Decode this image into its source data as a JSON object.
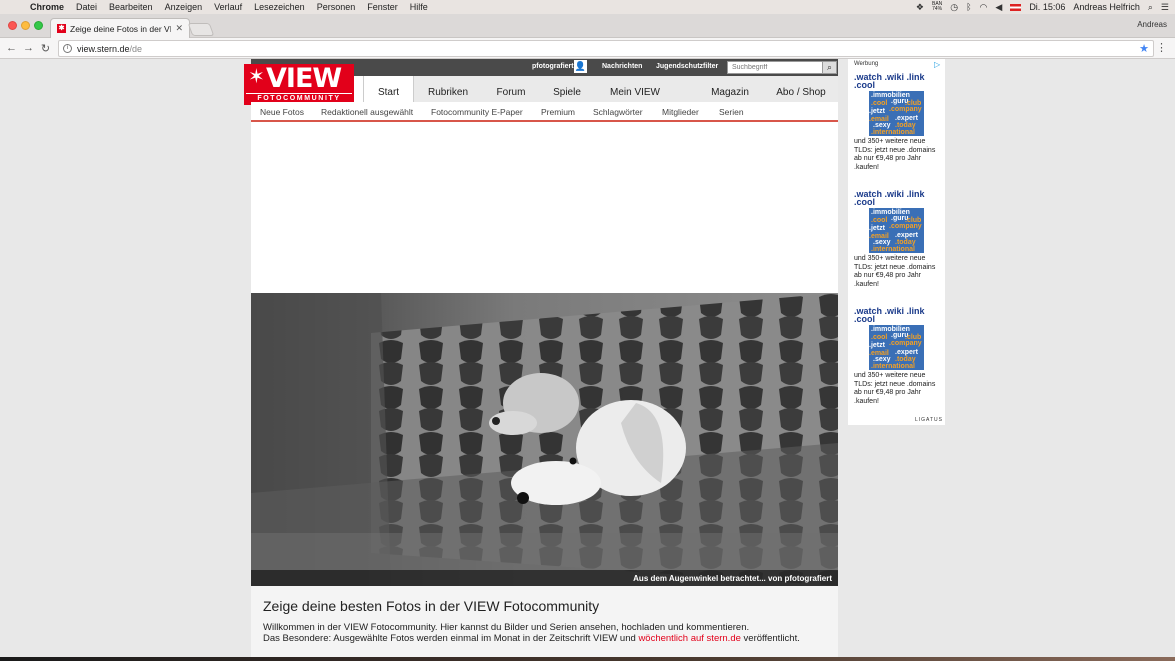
{
  "menubar": {
    "app": "Chrome",
    "items": [
      "Datei",
      "Bearbeiten",
      "Anzeigen",
      "Verlauf",
      "Lesezeichen",
      "Personen",
      "Fenster",
      "Hilfe"
    ],
    "battery": "74%",
    "battery_top": "BAN",
    "clock": "Di. 15:06",
    "user": "Andreas Helfrich"
  },
  "browser": {
    "tab_title": "Zeige deine Fotos in der VIEW",
    "profile": "Andreas",
    "url_host": "view.stern.de",
    "url_path": "/de"
  },
  "site": {
    "topbar": [
      "pfotografiert",
      "Nachrichten",
      "Jugendschutzfilter"
    ],
    "search_placeholder": "Suchbegriff",
    "logo_word": "VIEW",
    "logo_sub": "FOTOCOMMUNITY",
    "main_nav": [
      "Start",
      "Rubriken",
      "Forum",
      "Spiele",
      "Mein VIEW",
      "Magazin",
      "Abo / Shop"
    ],
    "sub_nav": [
      "Neue Fotos",
      "Redaktionell ausgewählt",
      "Fotocommunity E-Paper",
      "Premium",
      "Schlagwörter",
      "Mitglieder",
      "Serien"
    ],
    "hero_caption": "Aus dem Augenwinkel betrachtet... von pfotografiert",
    "headline": "Zeige deine besten Fotos in der VIEW Fotocommunity",
    "intro_line1": "Willkommen in der VIEW Fotocommunity. Hier kannst du Bilder und Serien ansehen, hochladen und kommentieren.",
    "intro_line2_prefix": "Das Besondere: Ausgewählte Fotos werden einmal im Monat in der Zeitschrift VIEW und ",
    "intro_link": "wöchentlich auf stern.de",
    "intro_line2_suffix": " veröffentlicht."
  },
  "ad": {
    "label": "Werbung",
    "headline": ".watch .wiki .link .cool",
    "image_words": [
      ".immobilien",
      ".cool",
      ".guru",
      ".club",
      ".jetzt",
      ".company",
      ".email",
      ".expert",
      ".sexy",
      ".today",
      ".international"
    ],
    "text": "und 350+ weitere neue TLDs: jetzt neue .domains ab nur €9,48 pro Jahr .kaufen!",
    "footer": "LIGATUS"
  },
  "colors": {
    "brand_red": "#e2001a",
    "topbar": "#4a4a4a",
    "ad_blue": "#1a3a8a"
  }
}
